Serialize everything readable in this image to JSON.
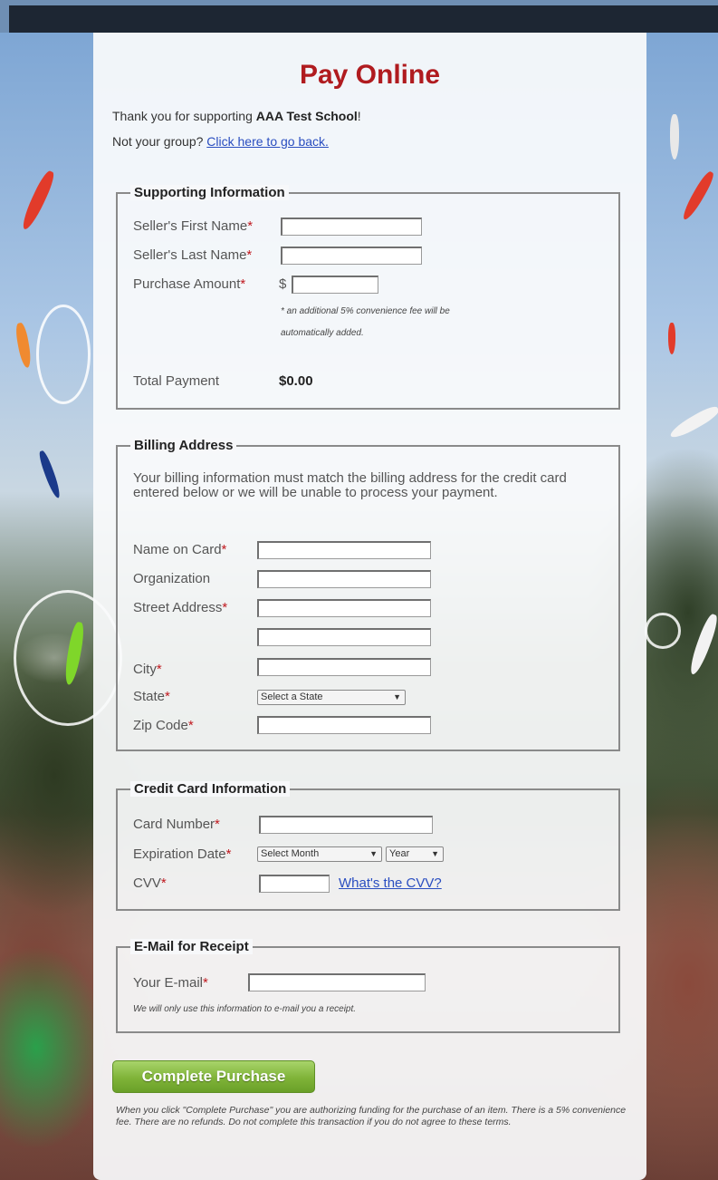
{
  "page": {
    "title": "Pay Online",
    "intro_prefix": "Thank you for supporting ",
    "school_name": "AAA Test School",
    "intro_suffix": "!",
    "not_group_text": "Not your group? ",
    "go_back_link": "Click here to go back."
  },
  "supporting": {
    "legend": "Supporting Information",
    "first_name_label": "Seller's First Name",
    "last_name_label": "Seller's Last Name",
    "amount_label": "Purchase Amount",
    "currency": "$",
    "fee_note_1": "* an additional 5% convenience fee will be",
    "fee_note_2": "automatically added.",
    "total_label": "Total Payment",
    "total_value": "$0.00"
  },
  "billing": {
    "legend": "Billing Address",
    "notice": "Your billing information must match the billing address for the credit card entered below or we will be unable to process your payment.",
    "name_label": "Name on Card",
    "org_label": "Organization",
    "street_label": "Street Address",
    "city_label": "City",
    "state_label": "State",
    "state_select": "Select a State",
    "zip_label": "Zip Code"
  },
  "card": {
    "legend": "Credit Card Information",
    "number_label": "Card Number",
    "exp_label": "Expiration Date",
    "month_select": "Select Month",
    "year_select": "Year",
    "cvv_label": "CVV",
    "cvv_link": "What's the CVV?"
  },
  "email": {
    "legend": "E-Mail for Receipt",
    "label": "Your E-mail",
    "note": "We will only use this information to e-mail you a receipt."
  },
  "required_marker": "*",
  "submit_label": "Complete Purchase",
  "terms": "When you click \"Complete Purchase\" you are authorizing funding for the purchase of an item. There is a 5% convenience fee. There are no refunds. Do not complete this transaction if you do not agree to these terms.",
  "colors": {
    "title": "#b01b1f",
    "required": "#c0191f",
    "link": "#2a4ec0",
    "button": "#7fb338"
  }
}
